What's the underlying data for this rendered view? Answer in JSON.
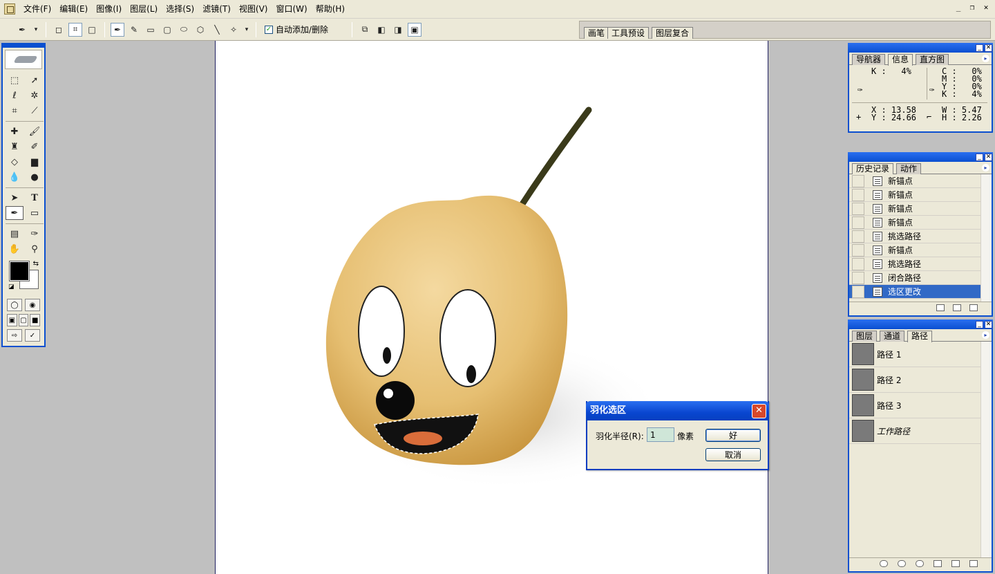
{
  "menubar": {
    "items": [
      "文件(F)",
      "编辑(E)",
      "图像(I)",
      "图层(L)",
      "选择(S)",
      "滤镜(T)",
      "视图(V)",
      "窗口(W)",
      "帮助(H)"
    ],
    "window_controls": [
      "_",
      "❐",
      "✕"
    ]
  },
  "optionsbar": {
    "auto_add_delete_label": "自动添加/删除",
    "auto_add_delete_checked": true,
    "palette_well_tabs": [
      "画笔",
      "工具预设",
      "图层复合"
    ]
  },
  "toolbox": {
    "tools": [
      "marquee-icon",
      "move-icon",
      "lasso-icon",
      "magic-wand-icon",
      "crop-icon",
      "slice-icon",
      "healing-brush-icon",
      "brush-icon",
      "clone-stamp-icon",
      "history-brush-icon",
      "eraser-icon",
      "gradient-icon",
      "blur-icon",
      "dodge-icon",
      "path-selection-icon",
      "type-icon",
      "pen-icon",
      "shape-icon",
      "notes-icon",
      "eyedropper-icon",
      "hand-icon",
      "zoom-icon"
    ],
    "foreground_color": "#000000",
    "background_color": "#ffffff"
  },
  "dialog": {
    "title": "羽化选区",
    "radius_label": "羽化半径(R):",
    "radius_value": "1",
    "unit": "像素",
    "ok_label": "好",
    "cancel_label": "取消"
  },
  "info_panel": {
    "tabs": [
      "导航器",
      "信息",
      "直方图"
    ],
    "active_tab": "信息",
    "k_left": "K :   4%",
    "c": "C :   0%",
    "m": "M :   0%",
    "y_cmyk": "Y :   0%",
    "k_right": "K :   4%",
    "x": "X : 13.58",
    "y": "Y : 24.66",
    "w": "W : 5.47",
    "h": "H : 2.26"
  },
  "history_panel": {
    "tabs": [
      "历史记录",
      "动作"
    ],
    "active_tab": "历史记录",
    "items": [
      "新锚点",
      "新锚点",
      "新锚点",
      "新锚点",
      "挑选路径",
      "新锚点",
      "挑选路径",
      "闭合路径",
      "选区更改"
    ],
    "selected_index": 8
  },
  "paths_panel": {
    "tabs": [
      "图层",
      "通道",
      "路径"
    ],
    "active_tab": "路径",
    "items": [
      "路径 1",
      "路径 2",
      "路径 3",
      "工作路径"
    ]
  },
  "colors": {
    "title_bar_blue": "#0a4fd0",
    "selection_blue": "#3169c6",
    "panel_bg": "#ece9d8",
    "workspace_gray": "#c0c0c0"
  }
}
